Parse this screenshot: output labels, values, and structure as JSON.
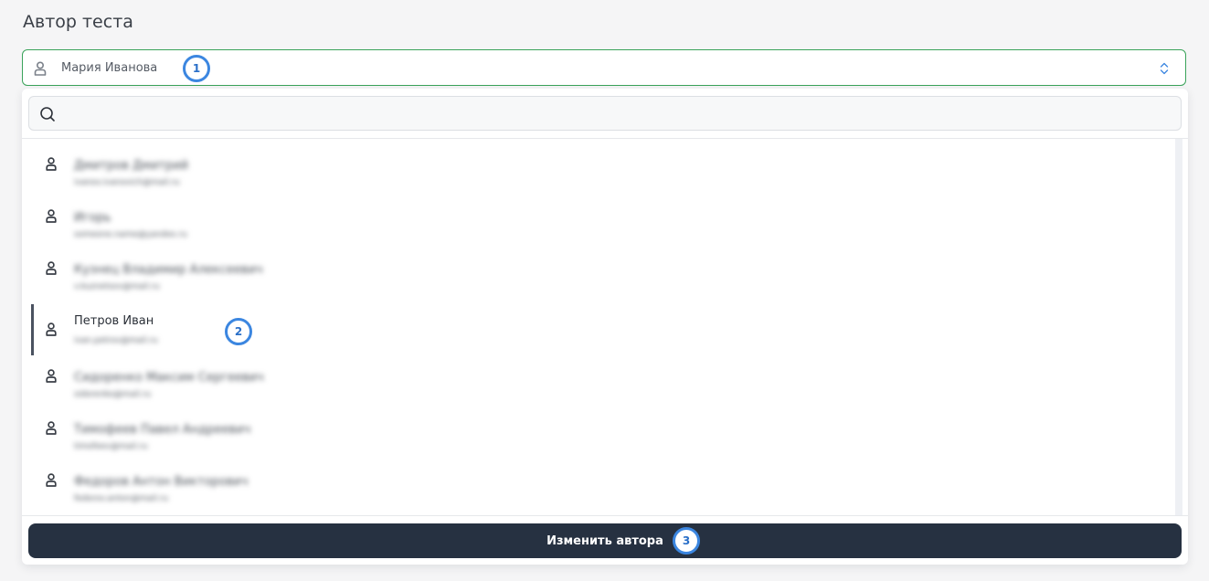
{
  "section_title": "Автор теста",
  "select": {
    "value": "Мария Иванова"
  },
  "search": {
    "value": "",
    "placeholder": ""
  },
  "users": [
    {
      "name": "Дмитров Дмитрий",
      "email": "ivanov.ivanovich@mail.ru"
    },
    {
      "name": "Игорь",
      "email": "someone.name@yandex.ru"
    },
    {
      "name": "Кузнец Владимир Алексеевич",
      "email": "v.kuznetsov@mail.ru"
    },
    {
      "name": "Петров Иван",
      "email": "ivan.petrov@mail.ru"
    },
    {
      "name": "Сидоренко Максим Сергеевич",
      "email": "sidorenko@mail.ru"
    },
    {
      "name": "Тимофеев Павел Андреевич",
      "email": "timofeev@mail.ru"
    },
    {
      "name": "Федоров Антон Викторович",
      "email": "fedorov.anton@mail.ru"
    }
  ],
  "submit_label": "Изменить автора",
  "badges": {
    "one": "1",
    "two": "2",
    "three": "3"
  },
  "colors": {
    "select_border": "#3aa35a",
    "badge_ring": "#3b86e0",
    "button_bg": "#263141",
    "active_marker": "#4a5260"
  },
  "icons": {
    "user": "user-icon",
    "search": "search-icon",
    "chevron": "chevron-up-down-icon"
  }
}
